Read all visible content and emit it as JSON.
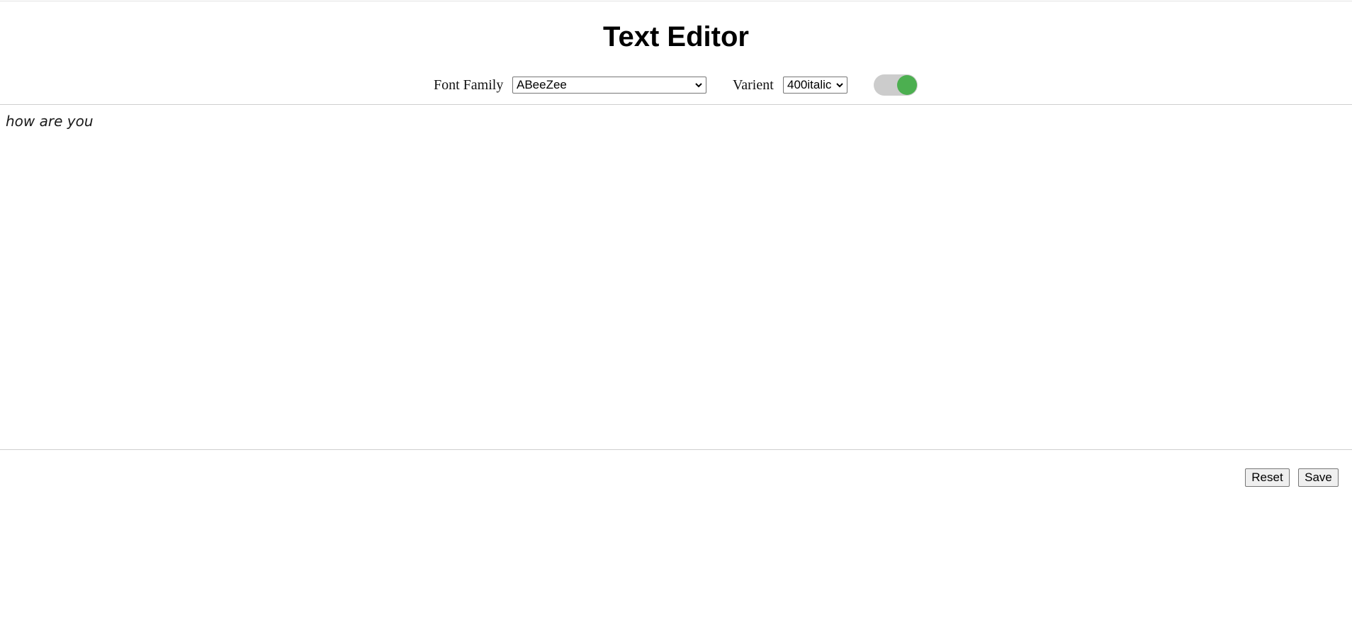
{
  "header": {
    "title": "Text Editor"
  },
  "toolbar": {
    "font_family_label": "Font Family",
    "font_family_value": "ABeeZee",
    "variant_label": "Varient",
    "variant_value": "400italic",
    "toggle_on": true,
    "toggle_color": "#4caf50"
  },
  "editor": {
    "text": "how are you"
  },
  "actions": {
    "reset_label": "Reset",
    "save_label": "Save"
  }
}
